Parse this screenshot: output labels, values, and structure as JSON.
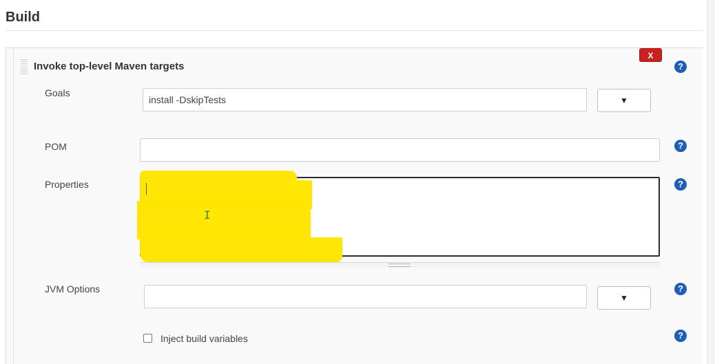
{
  "section": {
    "title": "Build"
  },
  "step": {
    "title": "Invoke top-level Maven targets",
    "delete_label": "X",
    "help_symbol": "?"
  },
  "fields": {
    "goals": {
      "label": "Goals",
      "value": "install -DskipTests",
      "dropdown": "▼"
    },
    "pom": {
      "label": "POM",
      "value": ""
    },
    "properties": {
      "label": "Properties",
      "value": ""
    },
    "jvm_options": {
      "label": "JVM Options",
      "value": "",
      "dropdown": "▼"
    },
    "inject": {
      "label": "Inject build variables",
      "checked": false
    }
  },
  "colors": {
    "delete": "#c9211e",
    "help": "#1e5db8",
    "highlight": "#ffe600"
  }
}
